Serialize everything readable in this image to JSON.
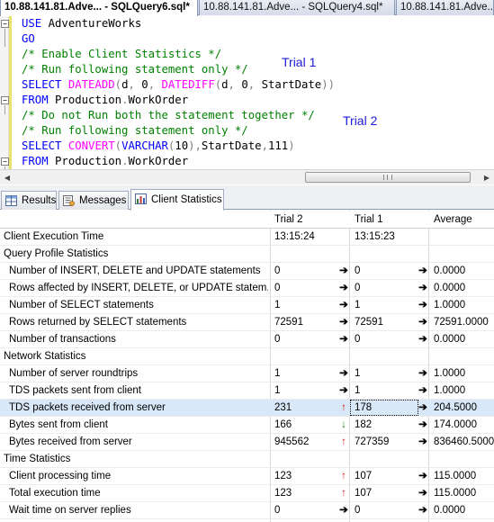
{
  "doc_tabs": [
    {
      "label": "10.88.141.81.Adve... - SQLQuery6.sql*",
      "active": true
    },
    {
      "label": "10.88.141.81.Adve... - SQLQuery4.sql*",
      "active": false
    },
    {
      "label": "10.88.141.81.Adve...",
      "active": false
    }
  ],
  "editor": {
    "lines": [
      [
        {
          "t": "USE",
          "c": "kw"
        },
        {
          "t": " AdventureWorks",
          "c": "tx"
        }
      ],
      [
        {
          "t": "GO",
          "c": "kw"
        }
      ],
      [
        {
          "t": "/* Enable Client Statistics */",
          "c": "cm"
        }
      ],
      [
        {
          "t": "/* Run following statement only */",
          "c": "cm"
        }
      ],
      [
        {
          "t": "SELECT",
          "c": "kw"
        },
        {
          "t": " ",
          "c": "tx"
        },
        {
          "t": "DATEADD",
          "c": "fn"
        },
        {
          "t": "(",
          "c": "gr"
        },
        {
          "t": "d",
          "c": "tx"
        },
        {
          "t": ",",
          "c": "gr"
        },
        {
          "t": " 0",
          "c": "tx"
        },
        {
          "t": ",",
          "c": "gr"
        },
        {
          "t": " ",
          "c": "tx"
        },
        {
          "t": "DATEDIFF",
          "c": "fn"
        },
        {
          "t": "(",
          "c": "gr"
        },
        {
          "t": "d",
          "c": "tx"
        },
        {
          "t": ",",
          "c": "gr"
        },
        {
          "t": " 0",
          "c": "tx"
        },
        {
          "t": ",",
          "c": "gr"
        },
        {
          "t": " StartDate",
          "c": "tx"
        },
        {
          "t": "))",
          "c": "gr"
        }
      ],
      [
        {
          "t": "FROM",
          "c": "kw"
        },
        {
          "t": " Production",
          "c": "tx"
        },
        {
          "t": ".",
          "c": "gr"
        },
        {
          "t": "WorkOrder",
          "c": "tx"
        }
      ],
      [
        {
          "t": "/* Do not Run both the statement together */",
          "c": "cm"
        }
      ],
      [
        {
          "t": "/* Run following statement only */",
          "c": "cm"
        }
      ],
      [
        {
          "t": "SELECT",
          "c": "kw"
        },
        {
          "t": " ",
          "c": "tx"
        },
        {
          "t": "CONVERT",
          "c": "fn"
        },
        {
          "t": "(",
          "c": "gr"
        },
        {
          "t": "VARCHAR",
          "c": "kw"
        },
        {
          "t": "(",
          "c": "gr"
        },
        {
          "t": "10",
          "c": "tx"
        },
        {
          "t": "),",
          "c": "gr"
        },
        {
          "t": "StartDate",
          "c": "tx"
        },
        {
          "t": ",",
          "c": "gr"
        },
        {
          "t": "111",
          "c": "tx"
        },
        {
          "t": ")",
          "c": "gr"
        }
      ],
      [
        {
          "t": "FROM",
          "c": "kw"
        },
        {
          "t": " Production",
          "c": "tx"
        },
        {
          "t": ".",
          "c": "gr"
        },
        {
          "t": "WorkOrder",
          "c": "tx"
        }
      ]
    ],
    "annotations": {
      "trial1": "Trial 1",
      "trial2": "Trial 2"
    },
    "outline_glyph": "−"
  },
  "result_tabs": [
    {
      "label": "Results",
      "icon": "grid-icon",
      "active": false
    },
    {
      "label": "Messages",
      "icon": "messages-icon",
      "active": false
    },
    {
      "label": "Client Statistics",
      "icon": "statistics-icon",
      "active": true
    }
  ],
  "stats": {
    "headers": {
      "trial2": "Trial  2",
      "trial1": "Trial  1",
      "average": "Average"
    },
    "rows": [
      {
        "kind": "data",
        "name": "Client Execution Time",
        "t2": "13:15:24",
        "a1": "",
        "t1": "13:15:23",
        "a2": "",
        "avg": "",
        "indent": false
      },
      {
        "kind": "section",
        "name": "Query Profile Statistics"
      },
      {
        "kind": "data",
        "name": "Number of INSERT, DELETE and UPDATE statements",
        "t2": "0",
        "a1": "right",
        "t1": "0",
        "a2": "right",
        "avg": "0.0000",
        "indent": true
      },
      {
        "kind": "data",
        "name": "Rows affected by INSERT, DELETE, or UPDATE statem...",
        "t2": "0",
        "a1": "right",
        "t1": "0",
        "a2": "right",
        "avg": "0.0000",
        "indent": true
      },
      {
        "kind": "data",
        "name": "Number of SELECT statements",
        "t2": "1",
        "a1": "right",
        "t1": "1",
        "a2": "right",
        "avg": "1.0000",
        "indent": true
      },
      {
        "kind": "data",
        "name": "Rows returned by SELECT statements",
        "t2": "72591",
        "a1": "right",
        "t1": "72591",
        "a2": "right",
        "avg": "72591.0000",
        "indent": true
      },
      {
        "kind": "data",
        "name": "Number of transactions",
        "t2": "0",
        "a1": "right",
        "t1": "0",
        "a2": "right",
        "avg": "0.0000",
        "indent": true
      },
      {
        "kind": "section",
        "name": "Network Statistics"
      },
      {
        "kind": "data",
        "name": "Number of server roundtrips",
        "t2": "1",
        "a1": "right",
        "t1": "1",
        "a2": "right",
        "avg": "1.0000",
        "indent": true
      },
      {
        "kind": "data",
        "name": "TDS packets sent from client",
        "t2": "1",
        "a1": "right",
        "t1": "1",
        "a2": "right",
        "avg": "1.0000",
        "indent": true
      },
      {
        "kind": "data",
        "name": "TDS packets received from server",
        "t2": "231",
        "a1": "up",
        "t1": "178",
        "a2": "right",
        "avg": "204.5000",
        "indent": true,
        "highlight": true
      },
      {
        "kind": "data",
        "name": "Bytes sent from client",
        "t2": "166",
        "a1": "down",
        "t1": "182",
        "a2": "right",
        "avg": "174.0000",
        "indent": true
      },
      {
        "kind": "data",
        "name": "Bytes received from server",
        "t2": "945562",
        "a1": "up",
        "t1": "727359",
        "a2": "right",
        "avg": "836460.5000",
        "indent": true
      },
      {
        "kind": "section",
        "name": "Time Statistics"
      },
      {
        "kind": "data",
        "name": "Client processing time",
        "t2": "123",
        "a1": "up",
        "t1": "107",
        "a2": "right",
        "avg": "115.0000",
        "indent": true
      },
      {
        "kind": "data",
        "name": "Total execution time",
        "t2": "123",
        "a1": "up",
        "t1": "107",
        "a2": "right",
        "avg": "115.0000",
        "indent": true
      },
      {
        "kind": "data",
        "name": "Wait time on server replies",
        "t2": "0",
        "a1": "right",
        "t1": "0",
        "a2": "right",
        "avg": "0.0000",
        "indent": true
      }
    ]
  },
  "arrow_glyphs": {
    "right": "➔",
    "up": "↑",
    "down": "↓"
  },
  "colors": {
    "keyword": "#0000ff",
    "function": "#ff00ff",
    "comment": "#008000",
    "annotation": "#1a1ad8",
    "up_arrow": "#d42020",
    "down_arrow": "#1a8f1a",
    "highlight_row": "#d9e8f8"
  }
}
